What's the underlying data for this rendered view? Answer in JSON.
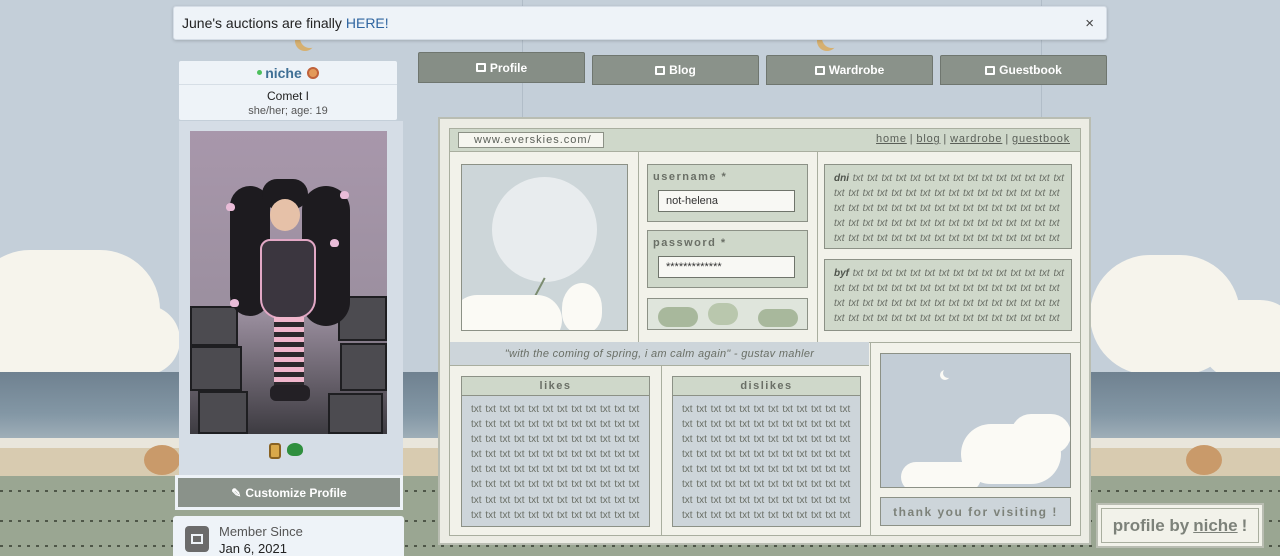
{
  "announcement": {
    "text": "June's auctions are finally",
    "link_text": "HERE!",
    "close_symbol": "×"
  },
  "profile": {
    "username": "niche",
    "rank": "Comet I",
    "pronouns": "she/her; age: 19",
    "customize_label": "Customize Profile",
    "member_since_label": "Member Since",
    "member_since_date": "Jan 6, 2021"
  },
  "tabs": [
    {
      "label": "Profile",
      "icon": "profile-icon"
    },
    {
      "label": "Blog",
      "icon": "blog-icon"
    },
    {
      "label": "Wardrobe",
      "icon": "wardrobe-icon"
    },
    {
      "label": "Guestbook",
      "icon": "guestbook-icon"
    }
  ],
  "layout": {
    "url": "www.everskies.com/",
    "nav": [
      "home",
      "blog",
      "wardrobe",
      "guestbook"
    ],
    "nav_separator": "|",
    "username_label": "username *",
    "username_value": "not-helena",
    "password_label": "password *",
    "password_value": "*************",
    "dni_label": "dni",
    "dni_text": "txt txt txt txt txt txt txt txt txt txt txt txt txt txt txt txt txt txt txt txt txt txt txt txt txt txt txt txt txt txt txt txt txt txt txt txt txt txt txt txt txt txt txt txt txt txt txt txt txt txt txt txt txt txt txt txt txt txt txt txt txt txt txt txt txt txt txt txt txt txt txt txt txt txt txt txt txt txt txt txt txt txt txt txt",
    "byf_label": "byf",
    "byf_text": "txt txt txt txt txt txt txt txt txt txt txt txt txt txt txt txt txt txt txt txt txt txt txt txt txt txt txt txt txt txt txt txt txt txt txt txt txt txt txt txt txt txt txt txt txt txt txt txt txt txt txt txt txt txt txt txt txt txt txt txt txt txt txt",
    "quote": "\"with the coming of spring, i am calm again\" - gustav mahler",
    "likes_title": "likes",
    "likes_text": "txt txt txt txt txt txt txt txt txt txt txt txt txt txt txt txt txt txt txt txt txt txt txt txt txt txt txt txt txt txt txt txt txt txt txt txt txt txt txt txt txt txt txt txt txt txt txt txt txt txt txt txt txt txt txt txt txt txt txt txt txt txt txt txt txt txt txt txt txt txt txt txt txt txt txt txt txt txt txt txt txt txt txt txt txt txt txt txt txt txt txt txt txt txt txt txt",
    "dislikes_title": "dislikes",
    "dislikes_text": "txt txt txt txt txt txt txt txt txt txt txt txt txt txt txt txt txt txt txt txt txt txt txt txt txt txt txt txt txt txt txt txt txt txt txt txt txt txt txt txt txt txt txt txt txt txt txt txt txt txt txt txt txt txt txt txt txt txt txt txt txt txt txt txt txt txt txt txt txt txt txt txt txt txt txt txt txt txt txt txt txt txt txt txt txt txt txt txt txt txt txt txt txt txt txt txt",
    "thanks": "thank you for visiting !"
  },
  "credit": {
    "prefix": "profile by",
    "name": "niche",
    "suffix": "!"
  },
  "colors": {
    "accent_tab": "#8a928a",
    "username": "#3f6f95",
    "link": "#2f65a0",
    "online": "#4cbf5c"
  }
}
